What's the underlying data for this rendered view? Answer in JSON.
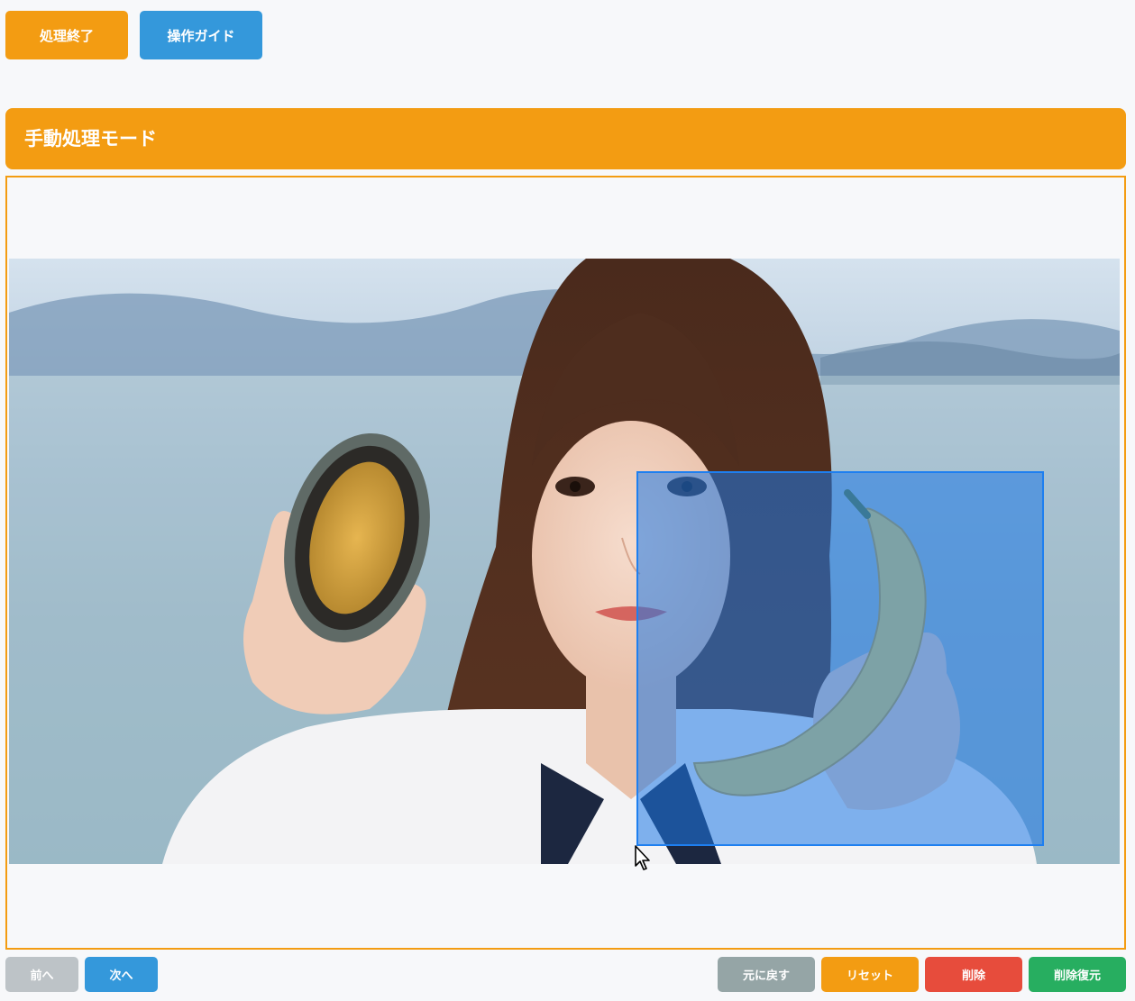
{
  "toolbar": {
    "finish_label": "処理終了",
    "guide_label": "操作ガイド"
  },
  "mode": {
    "title": "手動処理モード"
  },
  "navigation": {
    "prev_label": "前へ",
    "next_label": "次へ"
  },
  "actions": {
    "undo_label": "元に戻す",
    "reset_label": "リセット",
    "delete_label": "削除",
    "restore_label": "削除復元"
  },
  "colors": {
    "accent_orange": "#f39c12",
    "accent_blue": "#3498db",
    "disabled_gray": "#bdc3c7",
    "undo_gray": "#95a5a6",
    "delete_red": "#e74c3c",
    "restore_green": "#27ae60",
    "selection_blue": "#1e7ff0"
  },
  "icons": {
    "cursor": "mouse-pointer-icon"
  }
}
